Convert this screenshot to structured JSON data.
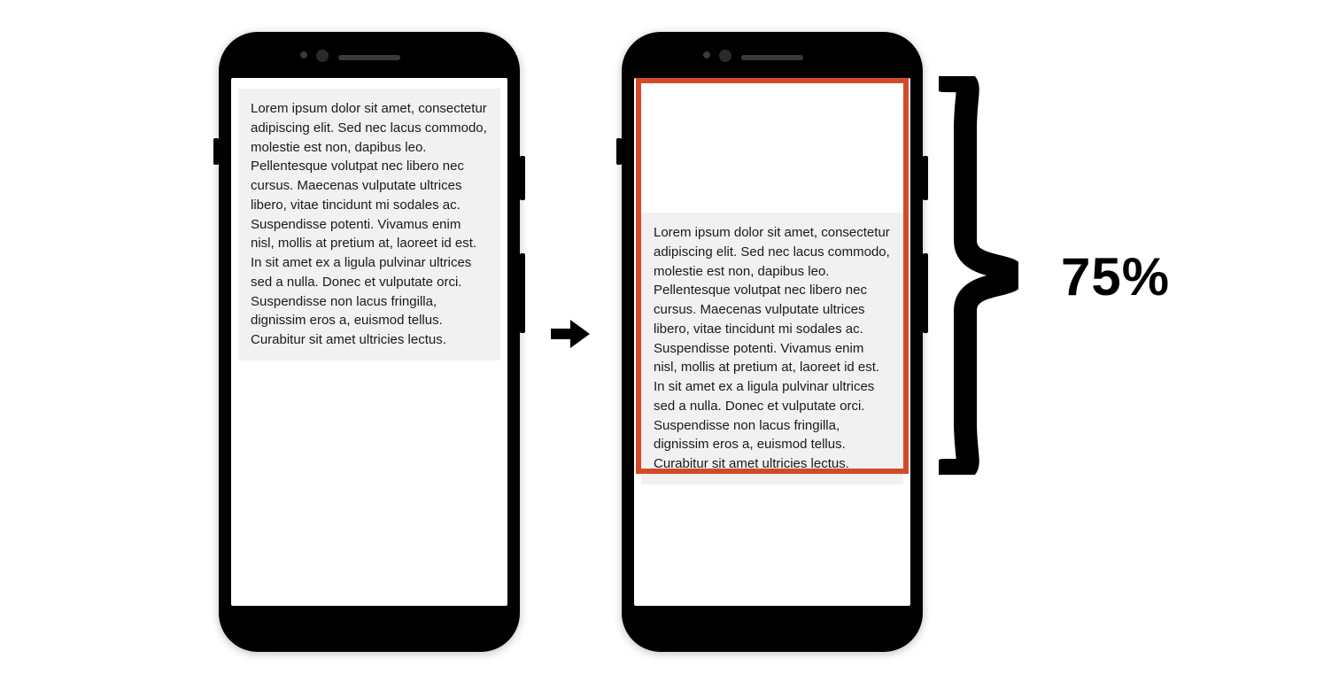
{
  "colors": {
    "highlight_border": "#d34a2a",
    "text_block_bg": "#f1f1f1"
  },
  "lorem_text": "Lorem ipsum dolor sit amet, consectetur adipiscing elit. Sed nec lacus commodo, molestie est non, dapibus leo. Pellentesque volutpat nec libero nec cursus. Maecenas vulputate ultrices libero, vitae tincidunt mi sodales ac. Suspendisse potenti. Vivamus enim nisl, mollis at pretium at, laoreet id est. In sit amet ex a ligula pulvinar ultrices sed a nulla. Donec et vulputate orci. Suspendisse non lacus fringilla, dignissim eros a, euismod tellus. Curabitur sit amet ultricies lectus.",
  "percentage_label": "75%",
  "highlight_fraction": 0.75
}
